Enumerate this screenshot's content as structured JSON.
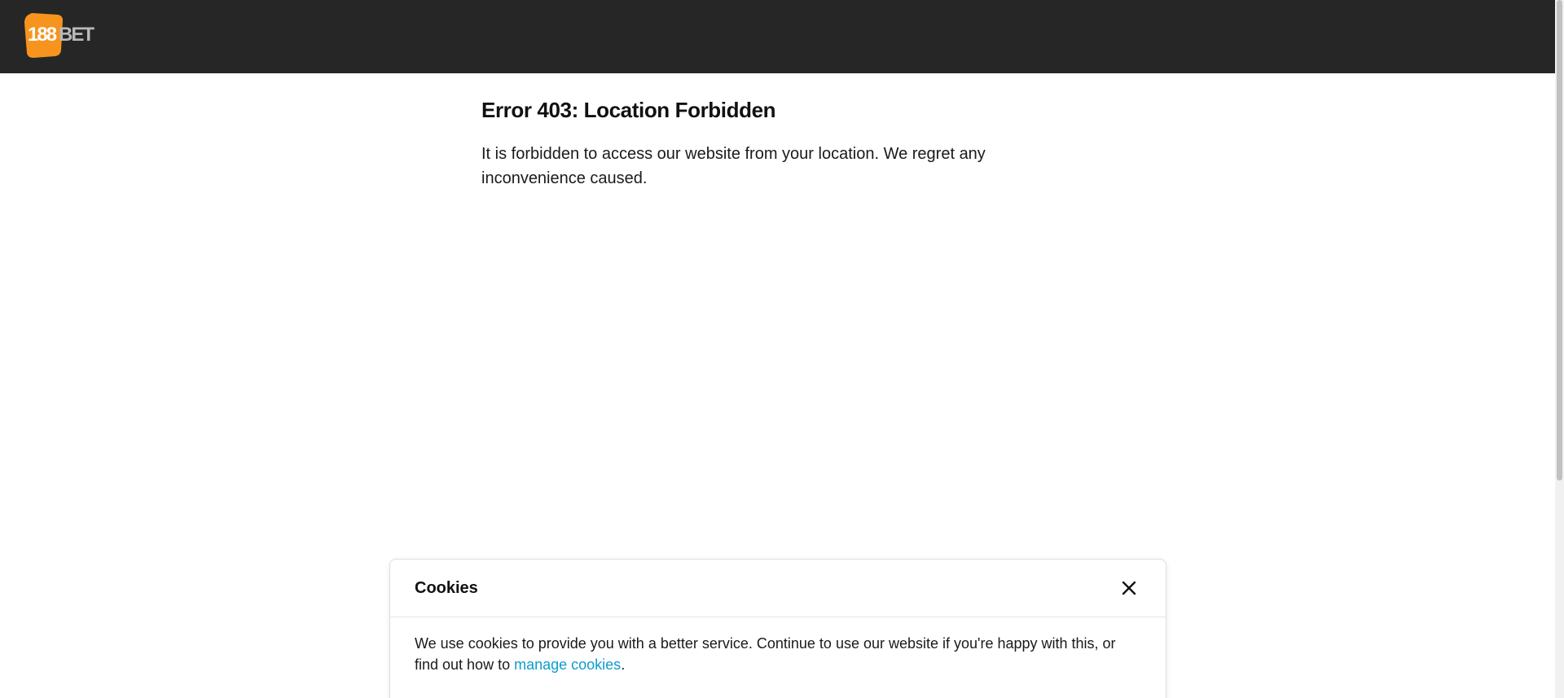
{
  "brand": {
    "logo_number": "188",
    "logo_word": "BET",
    "accent_color": "#f7941d",
    "header_color": "#262626"
  },
  "error": {
    "title": "Error 403: Location Forbidden",
    "message": "It is forbidden to access our website from your location. We regret any inconvenience caused."
  },
  "cookies": {
    "title": "Cookies",
    "close_icon": "close-icon",
    "text_before": "We use cookies to provide you with a better service. Continue to use our website if you're happy with this, or find out how to ",
    "link_label": "manage cookies",
    "text_after": ".",
    "link_color": "#0d9bcf"
  }
}
